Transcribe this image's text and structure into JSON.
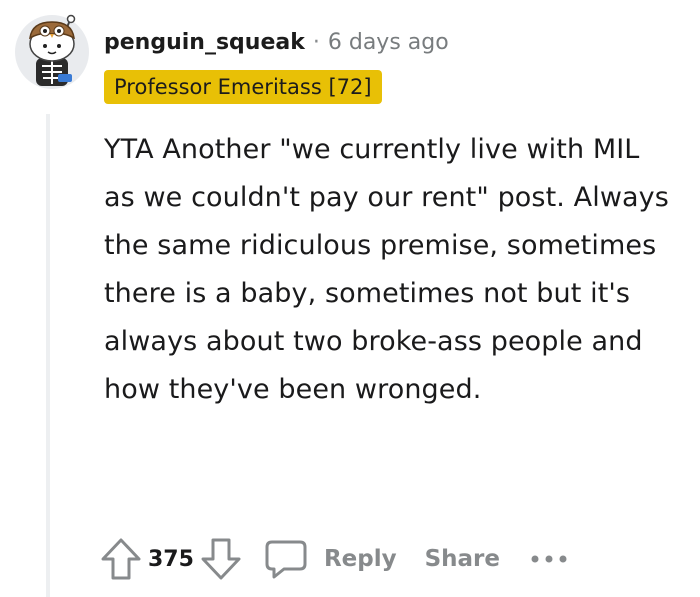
{
  "comment": {
    "username": "penguin_squeak",
    "separator": "·",
    "timestamp": "6 days ago",
    "flair": "Professor Emeritass [72]",
    "body": "YTA Another \"we currently live with MIL as we couldn't pay our rent\" post. Always the same ridiculous premise, sometimes there is a baby, sometimes not but it's always about two broke-ass people and how they've been wronged.",
    "score": "375"
  },
  "actions": {
    "reply_label": "Reply",
    "share_label": "Share",
    "upvote_icon": "upvote-arrow-icon",
    "downvote_icon": "downvote-arrow-icon",
    "reply_icon": "speech-bubble-icon",
    "more_icon": "ellipsis-icon"
  },
  "colors": {
    "flair_bg": "#e8c006",
    "muted_text": "#878a8c",
    "thread_line": "#edeff1"
  }
}
